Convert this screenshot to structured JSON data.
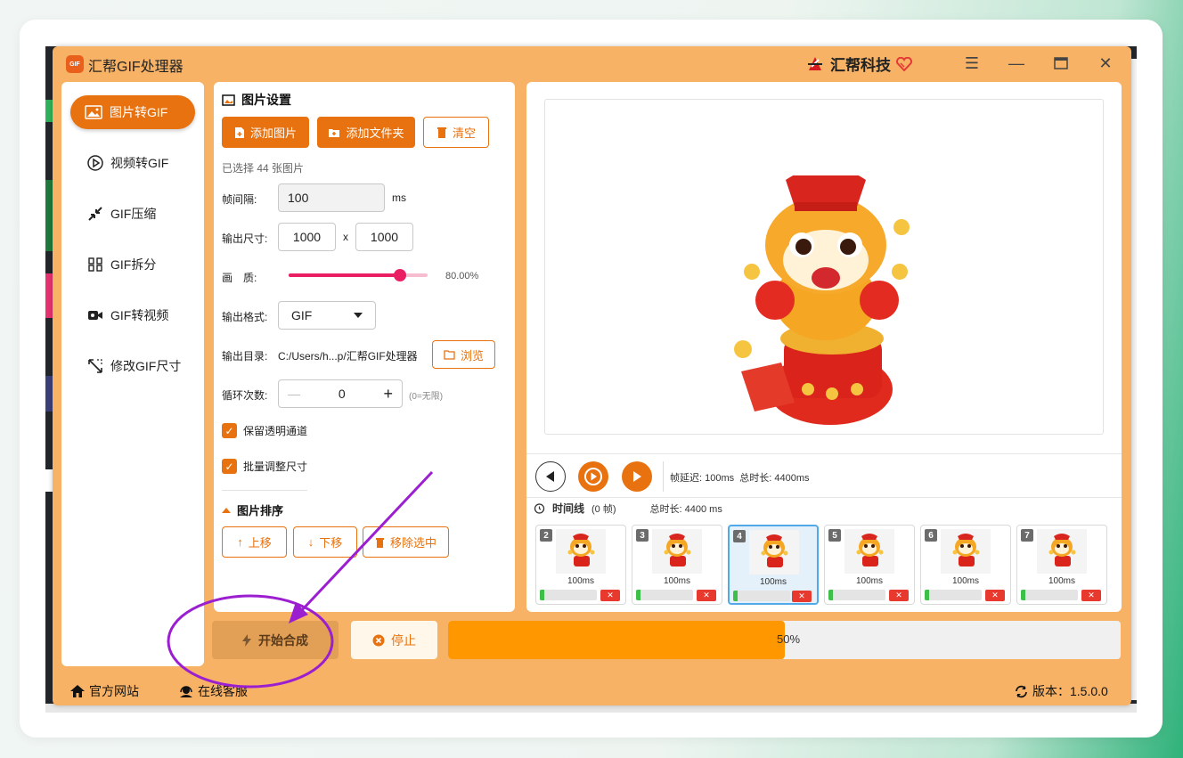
{
  "app": {
    "title": "汇帮GIF处理器",
    "brand": "汇帮科技",
    "logo_text": "GIF"
  },
  "sidebar": {
    "items": [
      {
        "label": "图片转GIF",
        "icon": "image-icon",
        "active": true
      },
      {
        "label": "视频转GIF",
        "icon": "video-play-icon"
      },
      {
        "label": "GIF压缩",
        "icon": "compress-icon"
      },
      {
        "label": "GIF拆分",
        "icon": "split-icon"
      },
      {
        "label": "GIF转视频",
        "icon": "camera-icon"
      },
      {
        "label": "修改GIF尺寸",
        "icon": "resize-icon"
      }
    ]
  },
  "settings": {
    "title": "图片设置",
    "add_image": "添加图片",
    "add_folder": "添加文件夹",
    "clear": "清空",
    "selected_info": "已选择 44 张图片",
    "interval_label": "帧间隔:",
    "interval_value": "100",
    "interval_unit": "ms",
    "size_label": "输出尺寸:",
    "width": "1000",
    "size_x": "x",
    "height": "1000",
    "quality_label": "画　质:",
    "quality_value": "80.00%",
    "quality_fraction": 0.8,
    "format_label": "输出格式:",
    "format_value": "GIF",
    "dir_label": "输出目录:",
    "dir_value": "C:/Users/h...p/汇帮GIF处理器",
    "browse": "浏览",
    "loop_label": "循环次数:",
    "loop_value": "0",
    "loop_hint": "(0=无限)",
    "keep_alpha": "保留透明通道",
    "batch_resize": "批量调整尺寸",
    "sort_title": "图片排序",
    "move_up": "上移",
    "move_down": "下移",
    "remove_selected": "移除选中"
  },
  "player": {
    "info": "帧延迟: 100ms  总时长: 4400ms",
    "timeline_label": "时间线",
    "timeline_frames": "(0 帧)",
    "timeline_total": "总时长: 4400 ms"
  },
  "frames": [
    {
      "num": "2",
      "dur": "100ms",
      "selected": false
    },
    {
      "num": "3",
      "dur": "100ms",
      "selected": false
    },
    {
      "num": "4",
      "dur": "100ms",
      "selected": true
    },
    {
      "num": "5",
      "dur": "100ms",
      "selected": false
    },
    {
      "num": "6",
      "dur": "100ms",
      "selected": false
    },
    {
      "num": "7",
      "dur": "100ms",
      "selected": false
    }
  ],
  "actions": {
    "start": "开始合成",
    "stop": "停止",
    "progress_text": "50%",
    "progress_fraction": 0.5
  },
  "footer": {
    "website": "官方网站",
    "support": "在线客服",
    "version": "版本：1.5.0.0"
  },
  "colors": {
    "accent": "#e8720f",
    "window": "#f7b265",
    "annotation": "#9b1fd0"
  }
}
